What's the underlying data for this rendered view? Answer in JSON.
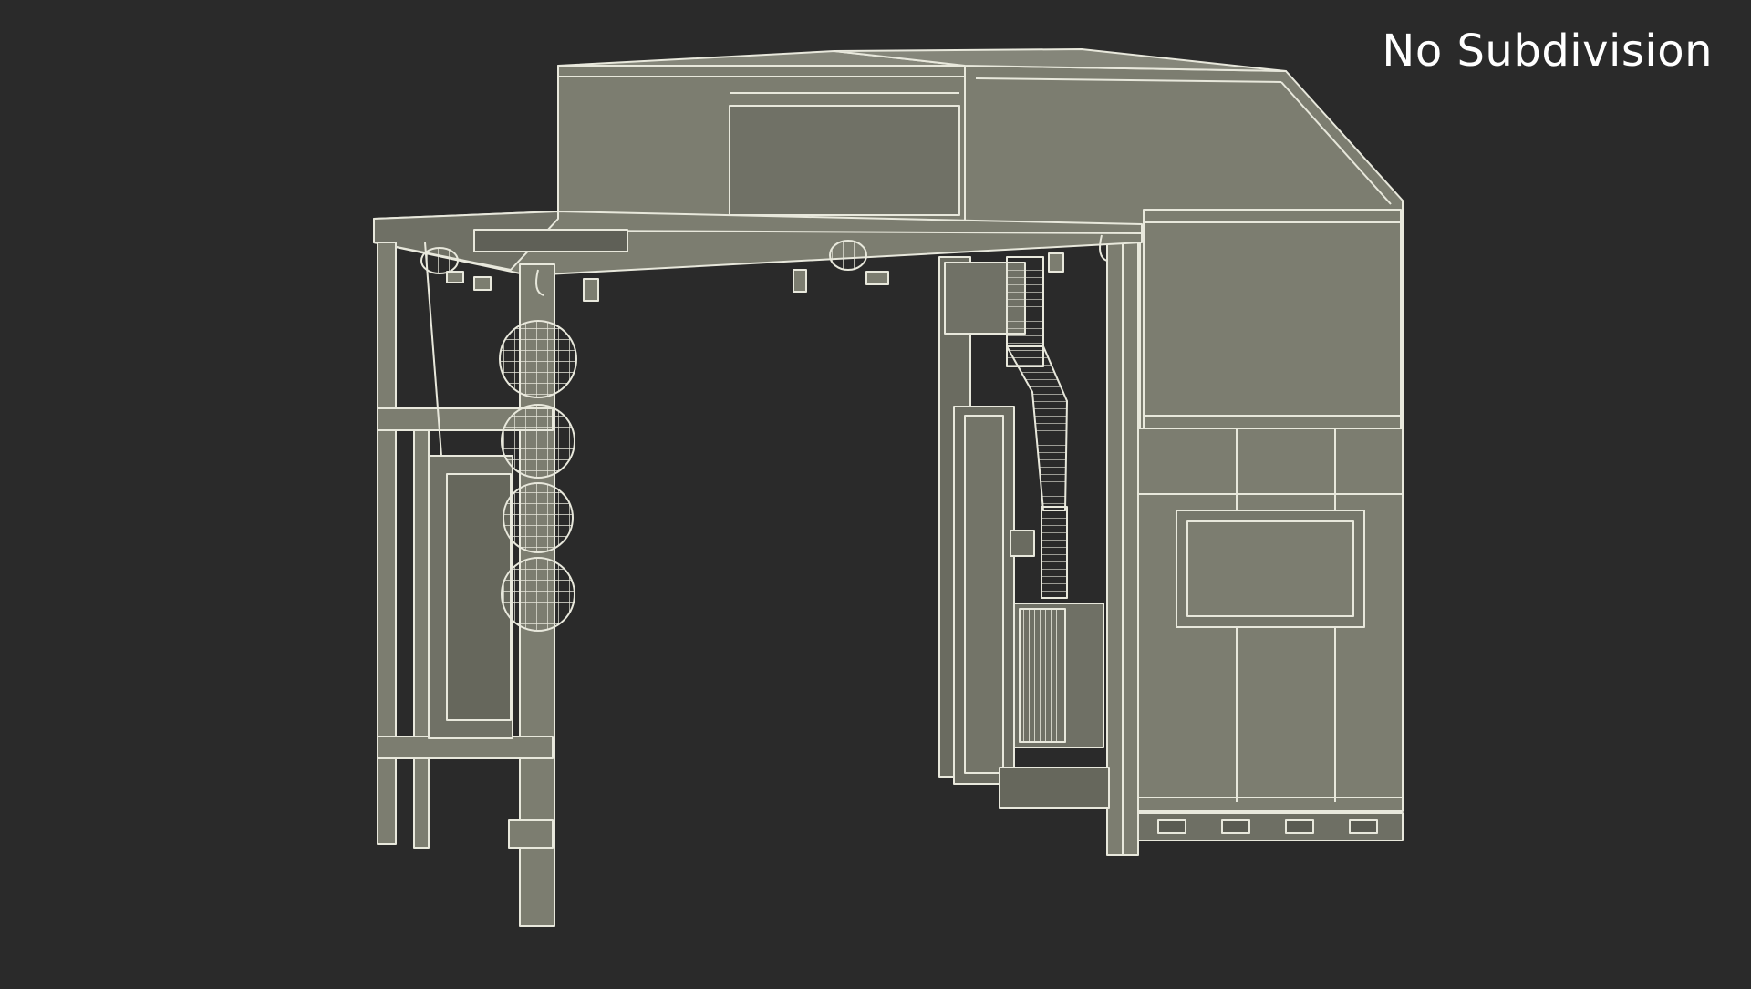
{
  "viewport": {
    "caption": "No Subdivision",
    "background": "#2a2a2a",
    "model_fill": "#7c7d70",
    "model_fill_dark": "#66675c",
    "wire_color": "#e8e8dc"
  }
}
